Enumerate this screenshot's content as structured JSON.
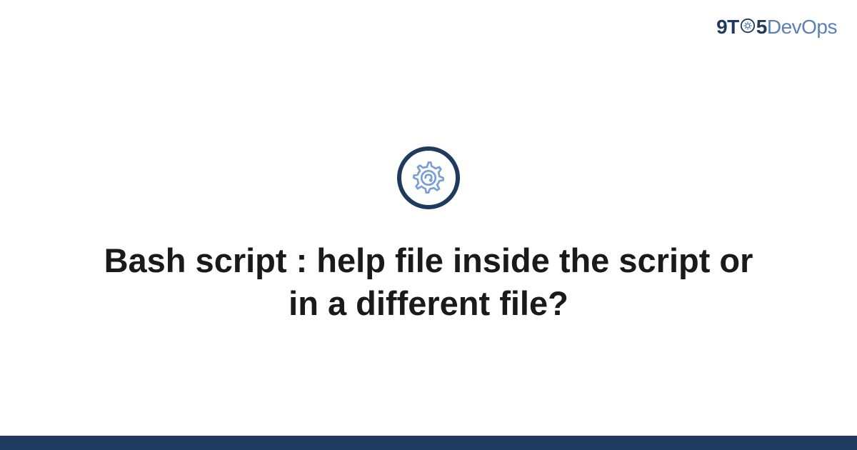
{
  "brand": {
    "prefix": "9T",
    "suffix": "5",
    "dev": "Dev",
    "ops": "Ops"
  },
  "title": "Bash script : help file inside the script or in a different file?",
  "colors": {
    "dark_blue": "#1f3a5f",
    "light_blue": "#5b7fb8"
  }
}
